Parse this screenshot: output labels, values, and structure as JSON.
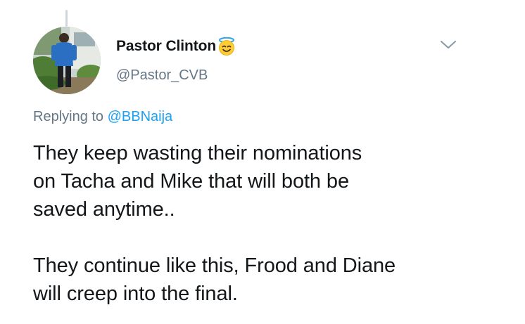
{
  "tweet": {
    "author": {
      "display_name": "Pastor Clinton",
      "name_emoji_icon": "smiling-face-with-halo-icon",
      "handle": "@Pastor_CVB"
    },
    "menu_icon": "chevron-down-icon",
    "reply": {
      "prefix": "Replying to",
      "mention": "@BBNaija"
    },
    "body": {
      "paragraph_1": "They keep wasting their nominations\non Tacha and Mike that will both be\nsaved anytime..",
      "paragraph_2": "They continue like this, Frood and Diane\nwill creep into the final."
    }
  },
  "colors": {
    "text_primary": "#14171a",
    "text_secondary": "#657786",
    "link": "#1da1f2",
    "thread_line": "#d0d6db"
  }
}
